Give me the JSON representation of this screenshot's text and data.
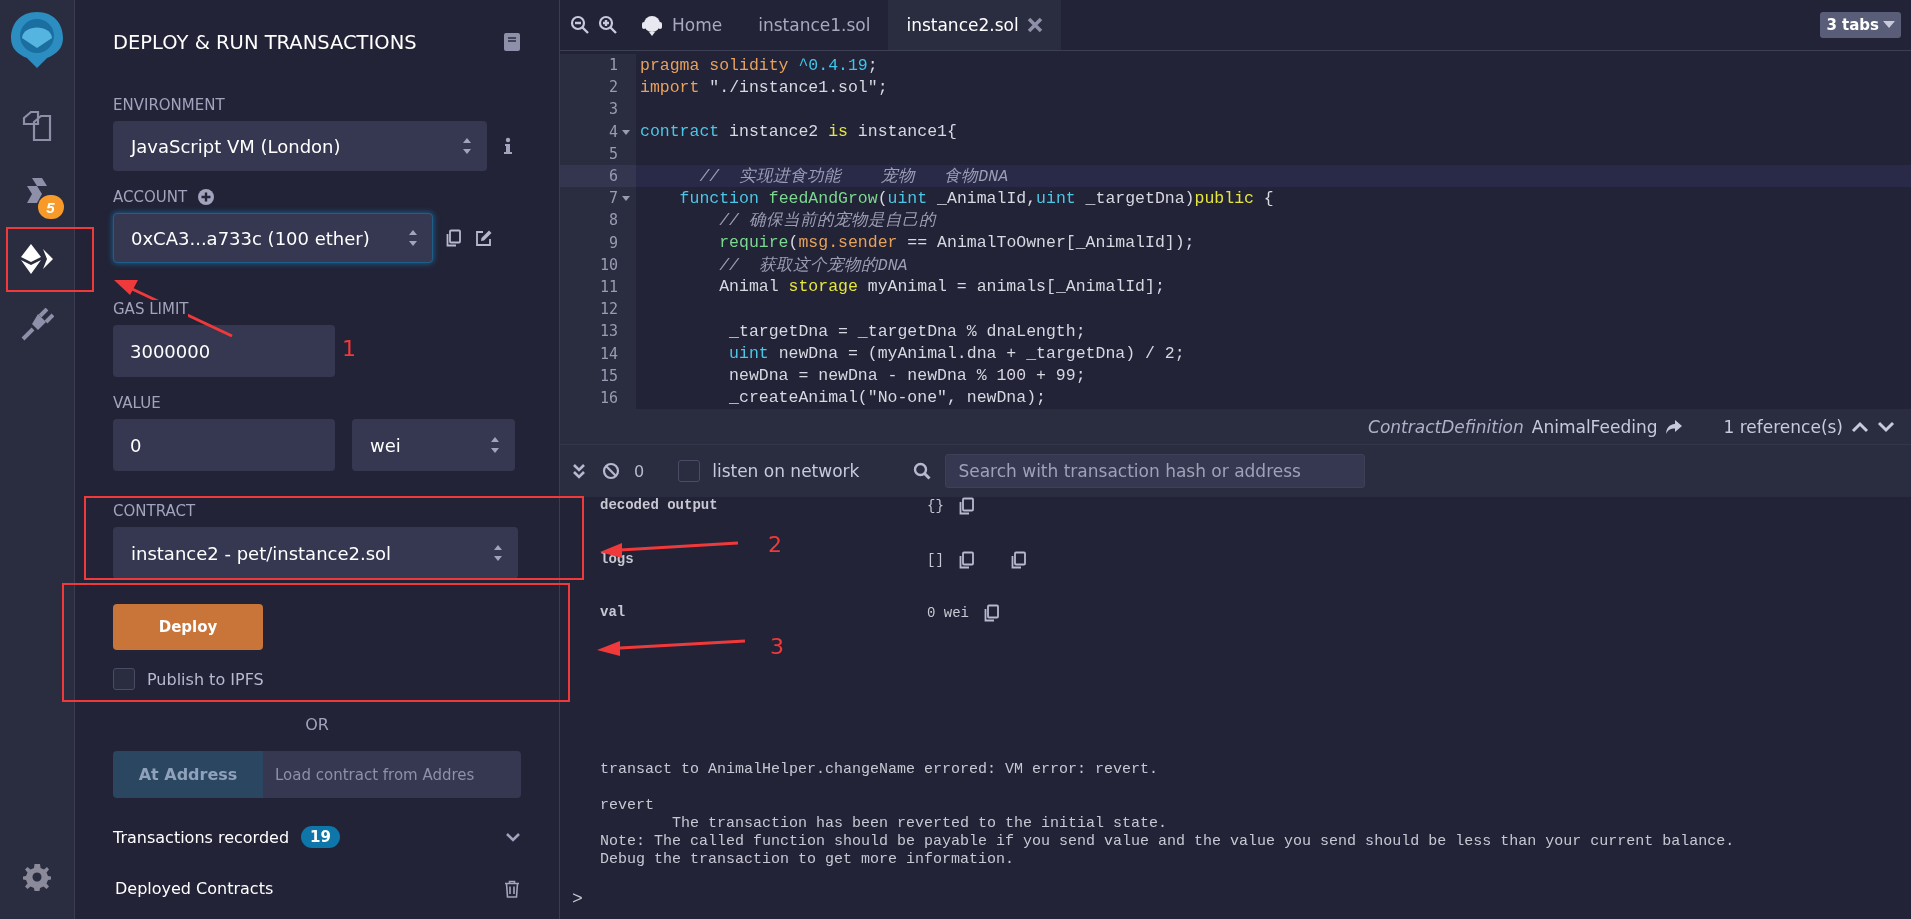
{
  "icon_bar": {
    "items": [
      {
        "kind": "files",
        "selected": false
      },
      {
        "kind": "compiler",
        "selected": false,
        "badge": "5"
      },
      {
        "kind": "deploy",
        "selected": true
      },
      {
        "kind": "plugin",
        "selected": false
      }
    ]
  },
  "panel": {
    "title": "DEPLOY & RUN TRANSACTIONS",
    "environment": {
      "label": "ENVIRONMENT",
      "value": "JavaScript VM (London)"
    },
    "account": {
      "label": "ACCOUNT",
      "value": "0xCA3...a733c (100 ether)",
      "focused": true
    },
    "gas_limit": {
      "label": "GAS LIMIT",
      "value": "3000000"
    },
    "value": {
      "label": "VALUE",
      "value": "0",
      "unit": "wei"
    },
    "contract": {
      "label": "CONTRACT",
      "value": "instance2 - pet/instance2.sol"
    },
    "deploy_button": "Deploy",
    "publish": {
      "label": "Publish to IPFS",
      "checked": false
    },
    "or": "OR",
    "at_address": {
      "button": "At Address",
      "placeholder": "Load contract from Addres"
    },
    "transactions": {
      "label": "Transactions recorded",
      "count": "19"
    },
    "deployed": {
      "label": "Deployed Contracts"
    }
  },
  "editor": {
    "tabs": [
      {
        "label": "Home",
        "kind": "home",
        "selected": false
      },
      {
        "label": "instance1.sol",
        "kind": "file",
        "selected": false
      },
      {
        "label": "instance2.sol",
        "kind": "file",
        "selected": true
      }
    ],
    "tab_count": "3 tabs",
    "lines": [
      {
        "number": "1",
        "fold": false,
        "active": false,
        "tokens": [
          {
            "kind": "keyword",
            "text": "pragma solidity "
          },
          {
            "kind": "number",
            "text": "^0.4.19"
          },
          {
            "kind": "plain",
            "text": ";"
          }
        ]
      },
      {
        "number": "2",
        "fold": false,
        "active": false,
        "tokens": [
          {
            "kind": "keyword",
            "text": "import"
          },
          {
            "kind": "plain",
            "text": " \"./instance1.sol\";"
          }
        ]
      },
      {
        "number": "3",
        "fold": false,
        "active": false
      },
      {
        "number": "4",
        "fold": true,
        "active": false,
        "tokens": [
          {
            "kind": "type",
            "text": "contract"
          },
          {
            "kind": "plain",
            "text": " instance2 "
          },
          {
            "kind": "modifier",
            "text": "is"
          },
          {
            "kind": "plain",
            "text": " instance1{"
          }
        ]
      },
      {
        "number": "5",
        "fold": false,
        "active": false
      },
      {
        "number": "6",
        "fold": false,
        "active": true,
        "tokens": [
          {
            "kind": "comment",
            "text": "      //  实现进食功能    宠物   食物DNA"
          }
        ]
      },
      {
        "number": "7",
        "fold": true,
        "active": false,
        "tokens": [
          {
            "kind": "type",
            "text": "    function"
          },
          {
            "kind": "call",
            "text": " feedAndGrow"
          },
          {
            "kind": "plain",
            "text": "("
          },
          {
            "kind": "type",
            "text": "uint"
          },
          {
            "kind": "plain",
            "text": " _AnimalId,"
          },
          {
            "kind": "type",
            "text": "uint"
          },
          {
            "kind": "plain",
            "text": " _targetDna)"
          },
          {
            "kind": "modifier",
            "text": "public"
          },
          {
            "kind": "plain",
            "text": " {"
          }
        ]
      },
      {
        "number": "8",
        "fold": false,
        "active": false,
        "tokens": [
          {
            "kind": "comment",
            "text": "        // 确保当前的宠物是自己的"
          }
        ]
      },
      {
        "number": "9",
        "fold": false,
        "active": false,
        "tokens": [
          {
            "kind": "call",
            "text": "        require"
          },
          {
            "kind": "plain",
            "text": "("
          },
          {
            "kind": "keyword",
            "text": "msg.sender"
          },
          {
            "kind": "plain",
            "text": " == AnimalToOwner[_AnimalId]);"
          }
        ]
      },
      {
        "number": "10",
        "fold": false,
        "active": false,
        "tokens": [
          {
            "kind": "comment",
            "text": "        //  获取这个宠物的DNA"
          }
        ]
      },
      {
        "number": "11",
        "fold": false,
        "active": false,
        "tokens": [
          {
            "kind": "plain",
            "text": "        Animal "
          },
          {
            "kind": "modifier",
            "text": "storage"
          },
          {
            "kind": "plain",
            "text": " myAnimal = animals[_AnimalId];"
          }
        ]
      },
      {
        "number": "12",
        "fold": false,
        "active": false
      },
      {
        "number": "13",
        "fold": false,
        "active": false,
        "tokens": [
          {
            "kind": "plain",
            "text": "         _targetDna = _targetDna % dnaLength;"
          }
        ]
      },
      {
        "number": "14",
        "fold": false,
        "active": false,
        "tokens": [
          {
            "kind": "type",
            "text": "         uint"
          },
          {
            "kind": "plain",
            "text": " newDna = (myAnimal.dna + _targetDna) / 2;"
          }
        ]
      },
      {
        "number": "15",
        "fold": false,
        "active": false,
        "tokens": [
          {
            "kind": "plain",
            "text": "         newDna = newDna - newDna % 100 + 99;"
          }
        ]
      },
      {
        "number": "16",
        "fold": false,
        "active": false,
        "tokens": [
          {
            "kind": "plain",
            "text": "         _createAnimal(\"No-one\", newDna);"
          }
        ]
      }
    ],
    "footer": {
      "definition_kind": "ContractDefinition",
      "definition_name": "AnimalFeeding",
      "references": "1 reference(s)"
    }
  },
  "terminal": {
    "count": "0",
    "listen": {
      "label": "listen on network",
      "checked": false
    },
    "search_placeholder": "Search with transaction hash or address",
    "rows": [
      {
        "key": "decoded output",
        "value": "{}",
        "kind": "single-copy"
      },
      {
        "key": "logs",
        "value": "[]",
        "kind": "double-copy"
      },
      {
        "key": "val",
        "value": "0 wei",
        "kind": "single-copy"
      }
    ],
    "error": "transact to AnimalHelper.changeName errored: VM error: revert.",
    "details": [
      "revert",
      "        The transaction has been reverted to the initial state.",
      "Note: The called function should be payable if you send value and the value you send should be less than your current balance.",
      "Debug the transaction to get more information."
    ],
    "prompt": ">"
  },
  "annotations": [
    {
      "label": "1"
    },
    {
      "label": "2"
    },
    {
      "label": "3"
    }
  ]
}
